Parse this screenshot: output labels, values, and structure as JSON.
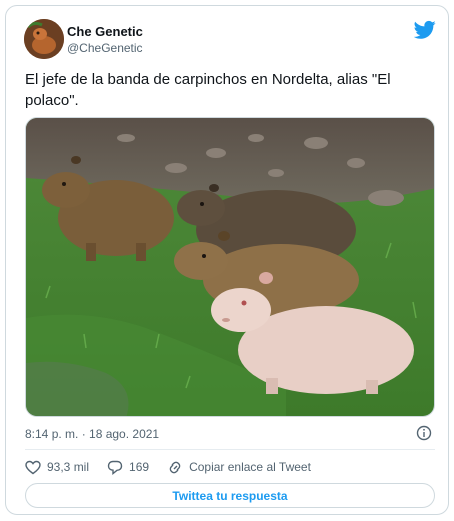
{
  "user": {
    "name": "Che Genetic",
    "handle": "@CheGenetic"
  },
  "tweet": {
    "text": "El jefe de la banda de carpinchos en Nordelta, alias \"El polaco\".",
    "timestamp": "8:14 p. m. · 18 ago. 2021"
  },
  "actions": {
    "likes": "93,3 mil",
    "replies": "169",
    "copy_link": "Copiar enlace al Tweet"
  },
  "reply_button": "Twittea tu respuesta",
  "colors": {
    "accent": "#1d9bf0",
    "muted": "#536471",
    "border": "#cfd9de"
  },
  "icons": [
    "twitter-bird-icon",
    "info-icon",
    "heart-icon",
    "reply-icon",
    "link-icon"
  ]
}
